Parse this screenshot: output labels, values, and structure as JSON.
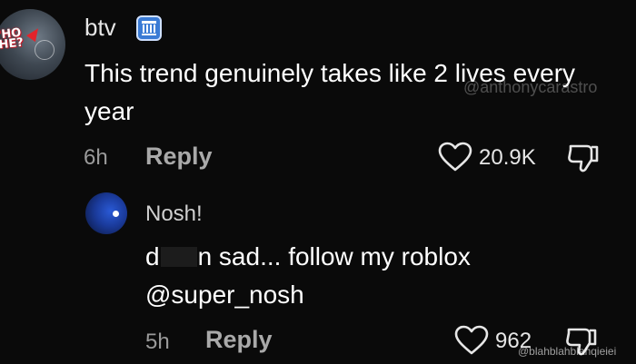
{
  "top_comment": {
    "avatar_text": "'HO\nHE?",
    "username": "btv",
    "badge_icon": "building-icon",
    "text": "This trend genuinely takes like 2 lives every year",
    "timestamp": "6h",
    "reply_label": "Reply",
    "likes": "20.9K",
    "watermark": "@anthonycarastro"
  },
  "reply_comment": {
    "username": "Nosh!",
    "text_start": "d",
    "text_after_censor": "n sad... follow my roblox @super_nosh",
    "timestamp": "5h",
    "reply_label": "Reply",
    "likes": "962",
    "watermark": "@blahblahblahqieiei"
  },
  "colors": {
    "background": "#0a0a0a",
    "badge": "#3a7bd5",
    "secondary_text": "#9a9a9a"
  }
}
